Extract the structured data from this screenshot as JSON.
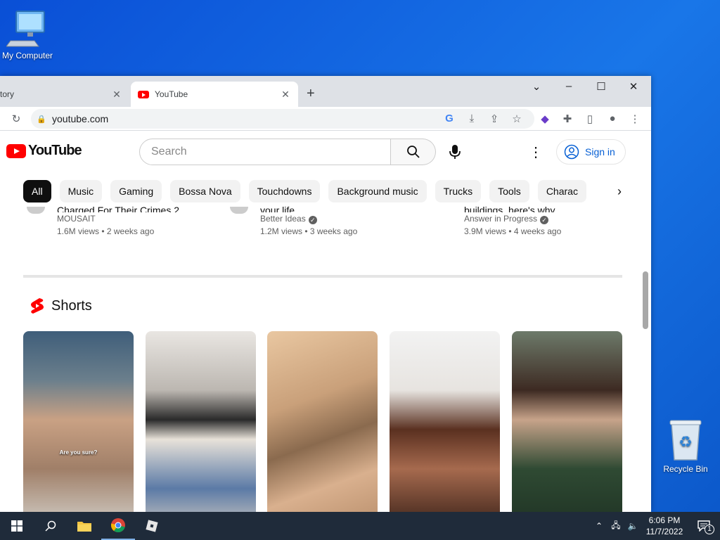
{
  "desktop": {
    "my_computer": "My Computer",
    "recycle_bin": "Recycle Bin"
  },
  "browser": {
    "tabs": [
      {
        "title": "tory",
        "active": false
      },
      {
        "title": "YouTube",
        "active": true
      }
    ],
    "address": "youtube.com"
  },
  "youtube": {
    "search_placeholder": "Search",
    "sign_in": "Sign in",
    "chips": [
      "All",
      "Music",
      "Gaming",
      "Bossa Nova",
      "Touchdowns",
      "Background music",
      "Trucks",
      "Tools",
      "Charac"
    ],
    "videos": [
      {
        "title": "Charged For Their Crimes 2",
        "channel": "MOUSAIT",
        "stats": "1.6M views • 2 weeks ago",
        "verified": false
      },
      {
        "title": "your life",
        "channel": "Better Ideas",
        "stats": "1.2M views • 3 weeks ago",
        "verified": true
      },
      {
        "title": "buildings, here's why",
        "channel": "Answer in Progress",
        "stats": "3.9M views • 4 weeks ago",
        "verified": true
      }
    ],
    "shorts_title": "Shorts",
    "short_overlay_text": "Are you sure?"
  },
  "taskbar": {
    "time": "6:06 PM",
    "date": "11/7/2022",
    "notifications": "1"
  },
  "colors": {
    "youtube_red": "#ff0000",
    "link_blue": "#065fd4",
    "taskbar": "#1f2b3a"
  }
}
